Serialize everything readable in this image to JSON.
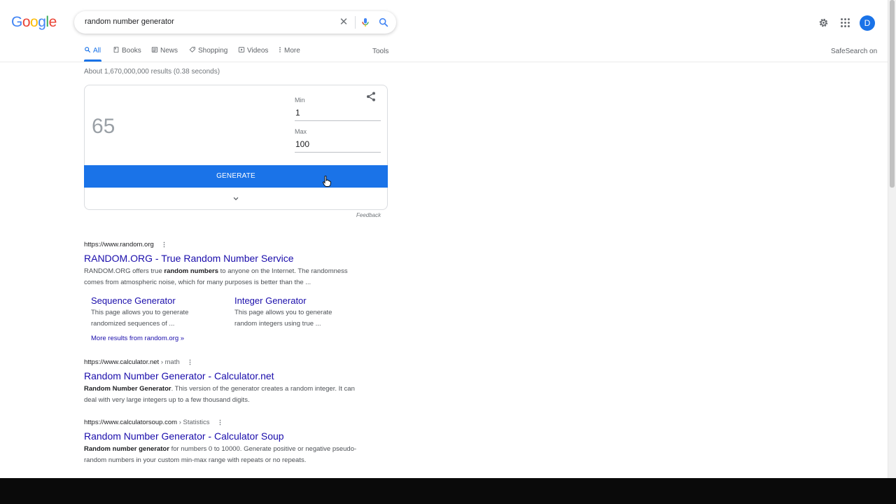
{
  "logo": {
    "letters": [
      "G",
      "o",
      "o",
      "g",
      "l",
      "e"
    ],
    "colors": [
      "#4285f4",
      "#ea4335",
      "#fbbc05",
      "#4285f4",
      "#34a853",
      "#ea4335"
    ]
  },
  "search": {
    "query": "random number generator"
  },
  "header": {
    "avatar_letter": "D"
  },
  "tabs": [
    {
      "label": "All",
      "icon": "search-icon"
    },
    {
      "label": "Books",
      "icon": "book-icon"
    },
    {
      "label": "News",
      "icon": "news-icon"
    },
    {
      "label": "Shopping",
      "icon": "tag-icon"
    },
    {
      "label": "Videos",
      "icon": "play-icon"
    },
    {
      "label": "More",
      "icon": "more-vert-icon"
    }
  ],
  "tools_label": "Tools",
  "safesearch_label": "SafeSearch on",
  "stats": "About 1,670,000,000 results (0.38 seconds)",
  "rng": {
    "result": "65",
    "min_label": "Min",
    "min_value": "1",
    "max_label": "Max",
    "max_value": "100",
    "generate_label": "GENERATE",
    "feedback_label": "Feedback"
  },
  "results": [
    {
      "url": "https://www.random.org",
      "crumb": "",
      "title": "RANDOM.ORG - True Random Number Service",
      "snippet_pre": "RANDOM.ORG offers true ",
      "snippet_bold": "random numbers",
      "snippet_post": " to anyone on the Internet. The randomness comes from atmospheric noise, which for many purposes is better than the ...",
      "sitelinks": [
        {
          "title": "Sequence Generator",
          "desc": "This page allows you to generate randomized sequences of ..."
        },
        {
          "title": "Integer Generator",
          "desc": "This page allows you to generate random integers using true ..."
        }
      ],
      "more_results": "More results from random.org »"
    },
    {
      "url": "https://www.calculator.net",
      "crumb": " › math",
      "title": "Random Number Generator - Calculator.net",
      "snippet_bold": "Random Number Generator",
      "snippet_post": ". This version of the generator creates a random integer. It can deal with very large integers up to a few thousand digits."
    },
    {
      "url": "https://www.calculatorsoup.com",
      "crumb": " › Statistics",
      "title": "Random Number Generator - Calculator Soup",
      "snippet_bold": "Random number generator",
      "snippet_post": " for numbers 0 to 10000. Generate positive or negative pseudo-random numbers in your custom min-max range with repeats or no repeats."
    }
  ],
  "accent_color": "#1a73e8",
  "link_color": "#1a0dab"
}
